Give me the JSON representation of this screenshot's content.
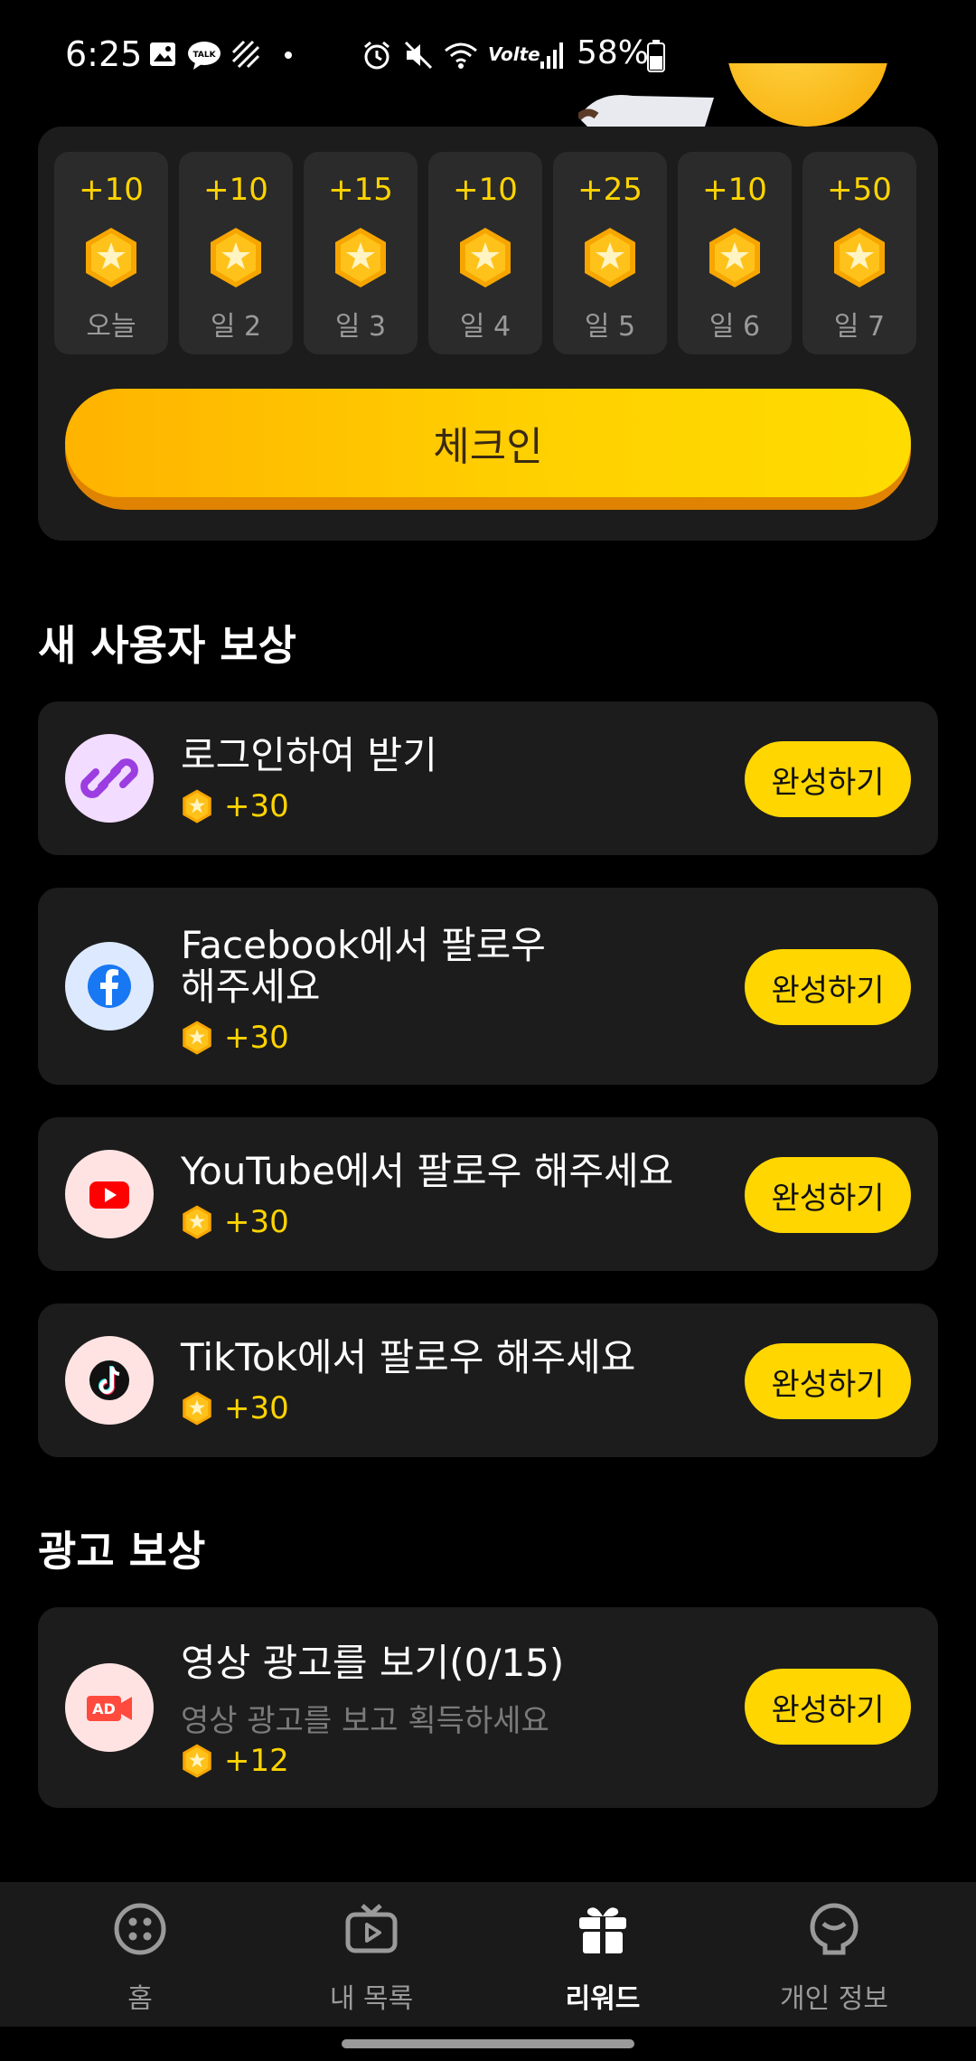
{
  "status_bar": {
    "time": "6:25",
    "battery": "58%",
    "network": "Volte",
    "icons": [
      "gallery-icon",
      "kakaotalk-icon",
      "stripes-icon",
      "dot-icon",
      "alarm-icon",
      "mute-icon",
      "wifi-icon",
      "signal-icon",
      "battery-icon"
    ]
  },
  "checkin": {
    "days": [
      {
        "points": "+10",
        "label": "오늘"
      },
      {
        "points": "+10",
        "label": "일 2"
      },
      {
        "points": "+15",
        "label": "일 3"
      },
      {
        "points": "+10",
        "label": "일 4"
      },
      {
        "points": "+25",
        "label": "일 5"
      },
      {
        "points": "+10",
        "label": "일 6"
      },
      {
        "points": "+50",
        "label": "일 7"
      }
    ],
    "button_label": "체크인"
  },
  "new_user_section": {
    "title": "새 사용자 보상",
    "tasks": [
      {
        "title": "로그인하여 받기",
        "reward": "+30",
        "button": "완성하기",
        "icon": "link-icon"
      },
      {
        "title_line1": "Facebook에서 팔로우",
        "title_line2": "해주세요",
        "reward": "+30",
        "button": "완성하기",
        "icon": "facebook-icon"
      },
      {
        "title": "YouTube에서 팔로우 해주세요",
        "reward": "+30",
        "button": "완성하기",
        "icon": "youtube-icon"
      },
      {
        "title": "TikTok에서 팔로우 해주세요",
        "reward": "+30",
        "button": "완성하기",
        "icon": "tiktok-icon"
      }
    ]
  },
  "ad_section": {
    "title": "광고 보상",
    "tasks": [
      {
        "title": "영상 광고를 보기(0/15)",
        "subtitle": "영상 광고를 보고 획득하세요",
        "reward": "+12",
        "button": "완성하기",
        "icon": "video-ad-icon",
        "icon_text": "AD"
      }
    ]
  },
  "nav": {
    "items": [
      {
        "label": "홈",
        "icon": "home-icon"
      },
      {
        "label": "내 목록",
        "icon": "tv-icon"
      },
      {
        "label": "리워드",
        "icon": "gift-icon",
        "active": true
      },
      {
        "label": "개인 정보",
        "icon": "profile-icon"
      }
    ]
  },
  "colors": {
    "accent": "#ffd600",
    "card": "#1c1c1c",
    "background": "#000000"
  }
}
